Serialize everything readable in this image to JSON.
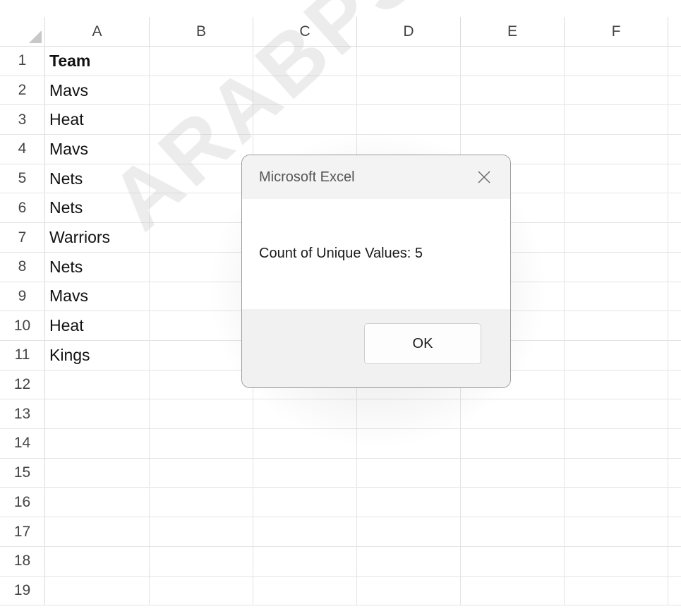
{
  "columns": [
    "A",
    "B",
    "C",
    "D",
    "E",
    "F"
  ],
  "rows": [
    {
      "num": "1",
      "a": "Team"
    },
    {
      "num": "2",
      "a": "Mavs"
    },
    {
      "num": "3",
      "a": "Heat"
    },
    {
      "num": "4",
      "a": "Mavs"
    },
    {
      "num": "5",
      "a": "Nets"
    },
    {
      "num": "6",
      "a": "Nets"
    },
    {
      "num": "7",
      "a": "Warriors"
    },
    {
      "num": "8",
      "a": "Nets"
    },
    {
      "num": "9",
      "a": "Mavs"
    },
    {
      "num": "10",
      "a": "Heat"
    },
    {
      "num": "11",
      "a": "Kings"
    },
    {
      "num": "12",
      "a": ""
    },
    {
      "num": "13",
      "a": ""
    },
    {
      "num": "14",
      "a": ""
    },
    {
      "num": "15",
      "a": ""
    },
    {
      "num": "16",
      "a": ""
    },
    {
      "num": "17",
      "a": ""
    },
    {
      "num": "18",
      "a": ""
    },
    {
      "num": "19",
      "a": ""
    }
  ],
  "dialog": {
    "title": "Microsoft Excel",
    "message": "Count of Unique Values: 5",
    "ok_label": "OK",
    "close_icon": "close-icon"
  },
  "watermark": {
    "text": "ARABPSYCHOL"
  }
}
